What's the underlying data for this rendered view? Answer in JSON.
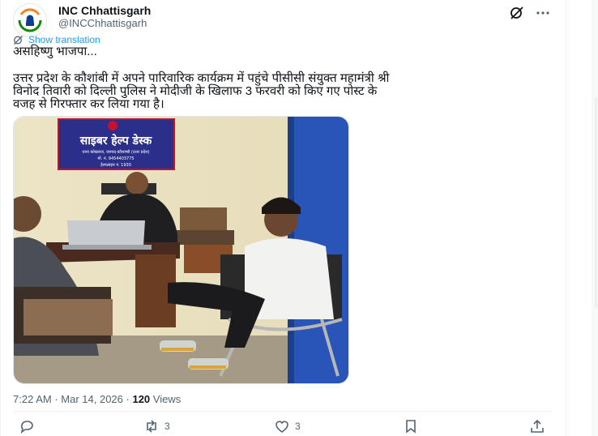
{
  "author": {
    "name": "INC Chhattisgarh",
    "handle": "@INCChhattisgarh"
  },
  "translate_label": "Show translation",
  "tweet_lines": [
    "असहिष्णु भाजपा...",
    "उत्तर प्रदेश के कौशांबी में अपने पारिवारिक कार्यक्रम में पहुंचे पीसीसी संयुक्त महामंत्री श्री",
    "विनोद तिवारी को दिल्ली पुलिस ने मोदीजी के खिलाफ 3 फरवरी को किए गए पोस्ट के",
    "वजह से गिरफ्तार कर लिया गया है।"
  ],
  "photo": {
    "sign_title": "साइबर हेल्प डेस्क",
    "sign_lines": [
      "थाना कोखराज, जनपद-कौशाम्बी (उत्तर प्रदेश)",
      "मो. नं. 9454403775",
      "हेल्पलाइन नं. 1930"
    ]
  },
  "meta": {
    "time": "7:22 AM",
    "date": "Mar 14, 2026",
    "views_count": "120",
    "views_label": "Views"
  },
  "actions": {
    "reposts": "3",
    "likes": "3"
  },
  "colors": {
    "accent": "#1d9bf0",
    "secondary_text": "#536471"
  }
}
